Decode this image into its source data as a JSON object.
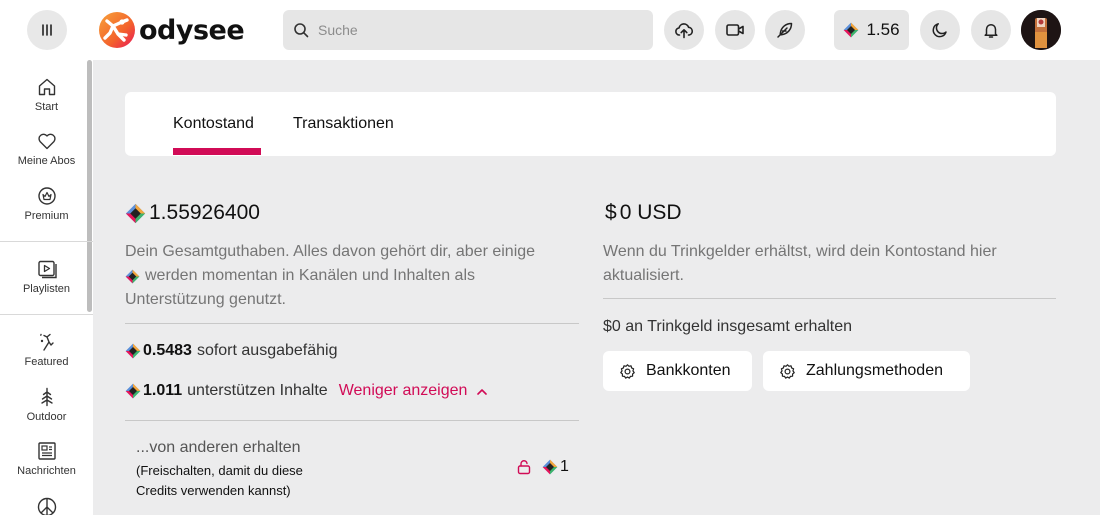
{
  "header": {
    "logo_text": "odysee",
    "search_placeholder": "Suche",
    "balance": "1.56",
    "colors": {
      "brand_pink": "#d10b56",
      "brand_orange": "#f3622c"
    },
    "icons": [
      "menu-icon",
      "search-icon",
      "upload-icon",
      "video-icon",
      "publish-icon",
      "credits-icon",
      "moon-icon",
      "bell-icon"
    ]
  },
  "sidebar": {
    "items": [
      {
        "label": "Start",
        "icon": "home-icon"
      },
      {
        "label": "Meine Abos",
        "icon": "heart-icon"
      },
      {
        "label": "Premium",
        "icon": "premium-icon"
      },
      {
        "label": "Playlisten",
        "icon": "playlist-icon"
      },
      {
        "label": "Featured",
        "icon": "featured-icon"
      },
      {
        "label": "Outdoor",
        "icon": "tree-icon"
      },
      {
        "label": "Nachrichten",
        "icon": "news-icon"
      }
    ]
  },
  "tabs": {
    "balance": "Kontostand",
    "transactions": "Transaktionen"
  },
  "lbc": {
    "total": "1.55926400",
    "desc_part1": "Dein Gesamtguthaben. Alles davon gehört dir, aber einige",
    "desc_part2": "werden momentan in Kanälen und Inhalten als",
    "desc_part3": "Unterstützung genutzt.",
    "spendable_value": "0.5483",
    "spendable_label": "sofort ausgabefähig",
    "supporting_value": "1.011",
    "supporting_label": "unterstützen Inhalte",
    "show_less": "Weniger anzeigen",
    "received_title": "...von anderen erhalten",
    "received_note": "(Freischalten, damit du diese Credits verwenden kannst)",
    "received_value": "1"
  },
  "usd": {
    "symbol": "$",
    "total": "0 USD",
    "desc": "Wenn du Trinkgelder erhältst, wird dein Kontostand hier aktualisiert.",
    "received_text": "$0 an Trinkgeld insgesamt erhalten",
    "bank_button": "Bankkonten",
    "payment_button": "Zahlungsmethoden"
  }
}
